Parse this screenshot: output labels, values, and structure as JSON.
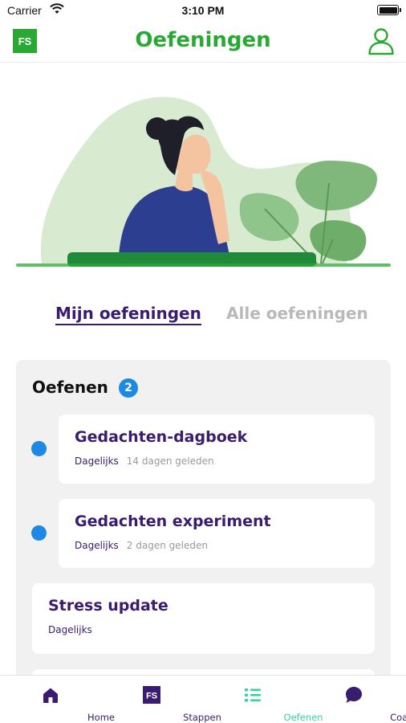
{
  "status_bar": {
    "carrier": "Carrier",
    "time": "3:10 PM"
  },
  "header": {
    "logo_text": "FS",
    "title": "Oefeningen"
  },
  "tabs": {
    "mine": "Mijn oefeningen",
    "all": "Alle oefeningen"
  },
  "panel": {
    "title": "Oefenen",
    "count": "2",
    "items": [
      {
        "title": "Gedachten-dagboek",
        "frequency": "Dagelijks",
        "last": "14 dagen geleden"
      },
      {
        "title": "Gedachten experiment",
        "frequency": "Dagelijks",
        "last": "2 dagen geleden"
      },
      {
        "title": "Stress update",
        "frequency": "Dagelijks"
      }
    ]
  },
  "bottom_nav": {
    "items": [
      {
        "label": "Home",
        "icon": "home-icon"
      },
      {
        "label": "Stappen",
        "icon": "fs-logo-icon"
      },
      {
        "label": "Oefenen",
        "icon": "list-icon",
        "active": true
      },
      {
        "label": "Coach",
        "icon": "chat-bubble-icon"
      }
    ]
  },
  "colors": {
    "brand_green": "#2aa834",
    "purple": "#3a1c6e",
    "accent_blue": "#1e88e5",
    "active_teal": "#33d3a0"
  }
}
